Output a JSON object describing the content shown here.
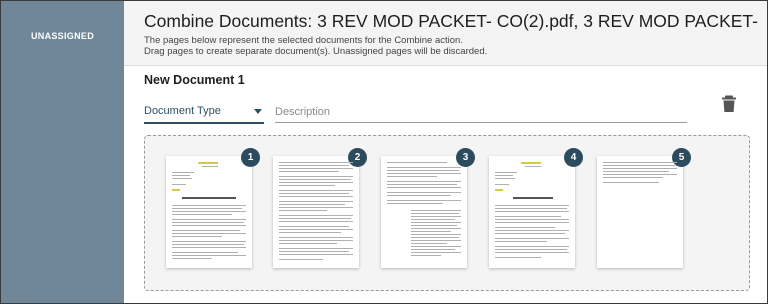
{
  "sidebar": {
    "label": "UNASSIGNED"
  },
  "header": {
    "title": "Combine Documents: 3 REV MOD PACKET- CO(2).pdf, 3 REV MOD PACKET- ...",
    "subtitle_line1": "The pages below represent the selected documents for the Combine action.",
    "subtitle_line2": "Drag pages to create separate document(s). Unassigned pages will be discarded."
  },
  "document": {
    "title": "New Document 1",
    "type_label": "Document Type",
    "description_placeholder": "Description"
  },
  "icons": {
    "trash": "trash-icon",
    "dropdown": "chevron-down-icon"
  },
  "pages": [
    {
      "number": "1"
    },
    {
      "number": "2"
    },
    {
      "number": "3"
    },
    {
      "number": "4"
    },
    {
      "number": "5"
    }
  ],
  "colors": {
    "sidebar": "#6f8799",
    "accent": "#2c5266",
    "badge": "#2c4b5e"
  }
}
